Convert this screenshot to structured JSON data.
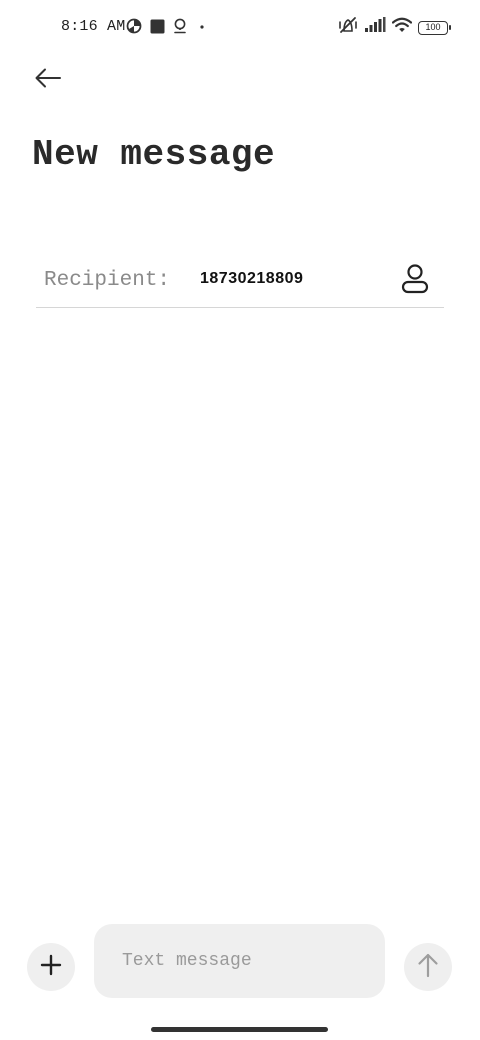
{
  "status_bar": {
    "time": "8:16 AM",
    "left_icons": [
      "data-saver-icon",
      "square-notification-icon",
      "pin-notification-icon",
      "dot-icon"
    ],
    "right_icons": [
      "vibrate-off-icon",
      "signal-icon",
      "wifi-icon",
      "battery-icon"
    ],
    "battery_level": "100"
  },
  "header": {
    "back_icon": "arrow-left-icon",
    "title": "New message"
  },
  "recipient": {
    "label": "Recipient:",
    "value": "18730218809",
    "picker_icon": "contact-person-icon"
  },
  "composer": {
    "add_icon": "plus-icon",
    "placeholder": "Text message",
    "value": "",
    "send_icon": "arrow-up-icon"
  },
  "colors": {
    "background": "#ffffff",
    "text": "#222222",
    "muted": "#8a8a8a",
    "chip": "#efefef",
    "divider": "#d6d6d6"
  }
}
